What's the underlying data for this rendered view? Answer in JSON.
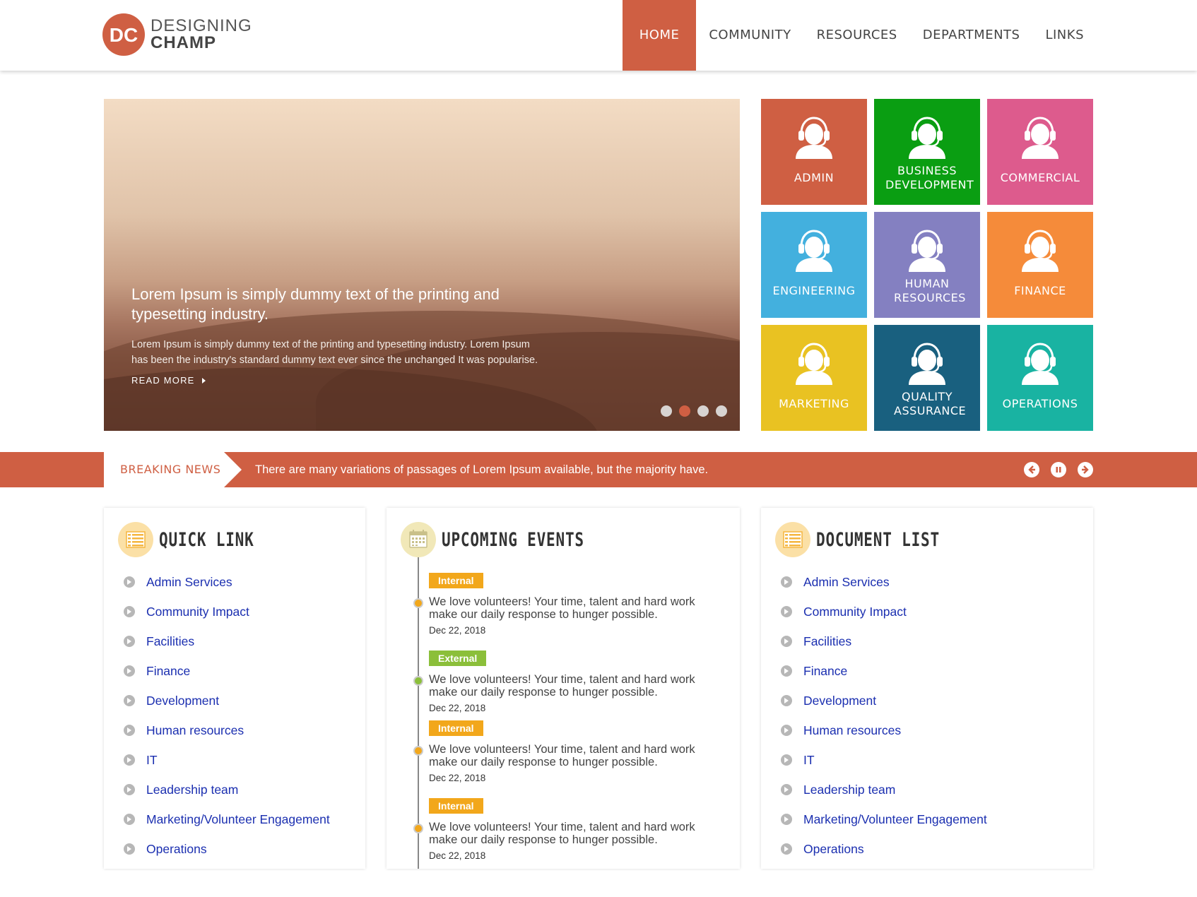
{
  "brand": {
    "line1": "DESIGNING",
    "line2": "CHAMP",
    "accent": "#cf5f43"
  },
  "nav": [
    {
      "label": "HOME",
      "active": true
    },
    {
      "label": "COMMUNITY"
    },
    {
      "label": "RESOURCES"
    },
    {
      "label": "DEPARTMENTS"
    },
    {
      "label": "LINKS"
    }
  ],
  "slider": {
    "title": "Lorem Ipsum is simply dummy text of the printing and typesetting industry.",
    "text": "Lorem Ipsum is simply dummy text of the printing and typesetting industry. Lorem Ipsum has been the industry's standard dummy text ever since the unchanged It was popularise.",
    "read_more": "READ MORE",
    "active_slide": 2,
    "slide_count": 4
  },
  "tiles": [
    {
      "label": "ADMIN",
      "color": "#cf5f43",
      "icon": "support-agent-icon"
    },
    {
      "label": "BUSINESS DEVELOPMENT",
      "color": "#0a9e12",
      "icon": "support-agent-icon"
    },
    {
      "label": "COMMERCIAL",
      "color": "#dd5b8d",
      "icon": "support-agent-icon"
    },
    {
      "label": "ENGINEERING",
      "color": "#43b0de",
      "icon": "support-agent-icon"
    },
    {
      "label": "HUMAN RESOURCES",
      "color": "#8480c1",
      "icon": "support-agent-icon"
    },
    {
      "label": "FINANCE",
      "color": "#f58b3a",
      "icon": "support-agent-icon"
    },
    {
      "label": "MARKETING",
      "color": "#e9c222",
      "icon": "support-agent-icon"
    },
    {
      "label": "QUALITY ASSURANCE",
      "color": "#19607f",
      "icon": "support-agent-icon"
    },
    {
      "label": "OPERATIONS",
      "color": "#19b3a2",
      "icon": "support-agent-icon"
    }
  ],
  "news": {
    "label": "BREAKING NEWS",
    "text": "There are many variations of passages of Lorem Ipsum available, but the majority have.",
    "controls": [
      "prev-icon",
      "pause-icon",
      "next-icon"
    ]
  },
  "quick_link": {
    "title": "QUICK LINK",
    "icon": "list-icon",
    "items": [
      "Admin Services",
      "Community Impact",
      "Facilities",
      "Finance",
      "Development",
      "Human resources",
      "IT",
      "Leadership team",
      "Marketing/Volunteer Engagement",
      "Operations"
    ]
  },
  "events": {
    "title": "UPCOMING EVENTS",
    "icon": "calendar-icon",
    "items": [
      {
        "tag": "Internal",
        "type": "internal",
        "text": "We love volunteers! Your time, talent and hard work make our daily response to hunger possible.",
        "date": "Dec 22, 2018"
      },
      {
        "tag": "External",
        "type": "external",
        "text": "We love volunteers! Your time, talent and hard work make our daily response to hunger possible.",
        "date": "Dec 22, 2018"
      },
      {
        "tag": "Internal",
        "type": "internal",
        "text": "We love volunteers! Your time, talent and hard work make our daily response to hunger possible.",
        "date": "Dec 22, 2018"
      },
      {
        "tag": "Internal",
        "type": "internal",
        "text": "We love volunteers! Your time, talent and hard work make our daily response to hunger possible.",
        "date": "Dec 22, 2018"
      }
    ]
  },
  "document_list": {
    "title": "DOCUMENT LIST",
    "icon": "list-icon",
    "items": [
      "Admin Services",
      "Community Impact",
      "Facilities",
      "Finance",
      "Development",
      "Human resources",
      "IT",
      "Leadership team",
      "Marketing/Volunteer Engagement",
      "Operations"
    ]
  }
}
